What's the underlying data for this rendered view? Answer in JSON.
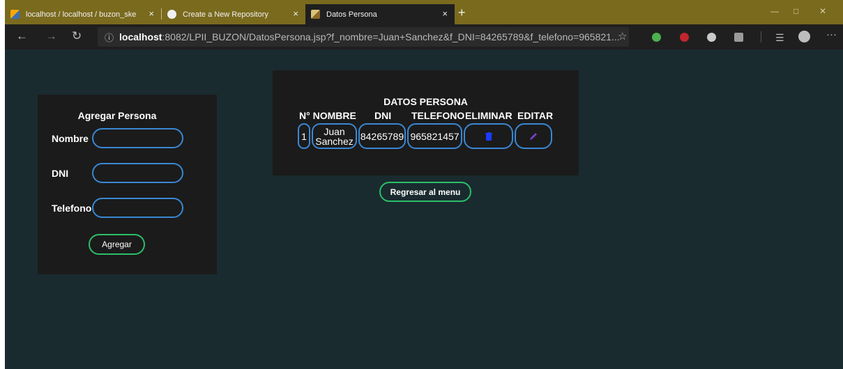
{
  "browser": {
    "tabs": [
      {
        "title": "localhost / localhost / buzon_ske"
      },
      {
        "title": "Create a New Repository"
      },
      {
        "title": "Datos Persona"
      }
    ],
    "close_glyph": "×",
    "new_tab_glyph": "+",
    "address": {
      "host": "localhost",
      "rest": ":8082/LPII_BUZON/DatosPersona.jsp?f_nombre=Juan+Sanchez&f_DNI=84265789&f_telefono=965821..."
    },
    "icons": {
      "back": "back-arrow-icon",
      "forward": "forward-arrow-icon",
      "refresh": "refresh-icon",
      "info": "info-icon",
      "star": "favorite-star-icon",
      "favorites": "favorites-list-icon",
      "profile": "profile-icon",
      "more": "more-icon"
    },
    "window": {
      "minimize": "—",
      "maximize": "□",
      "close": "✕"
    }
  },
  "form": {
    "title": "Agregar Persona",
    "fields": [
      {
        "label": "Nombre",
        "value": ""
      },
      {
        "label": "DNI",
        "value": ""
      },
      {
        "label": "Telefono",
        "value": ""
      }
    ],
    "submit_label": "Agregar"
  },
  "table": {
    "title": "DATOS PERSONA",
    "headers": [
      "N° NOMBRE",
      "DNI",
      "TELEFONO",
      "ELIMINAR",
      "EDITAR"
    ],
    "rows": [
      {
        "n": "1",
        "nombre": "Juan Sanchez",
        "dni": "84265789",
        "telefono": "965821457"
      }
    ],
    "delete_icon": "trash-icon",
    "edit_icon": "pencil-icon"
  },
  "back_label": "Regresar al menu",
  "colors": {
    "tab_bar": "#7a6a1e",
    "page_bg": "#1a2b30",
    "panel_bg": "#1b1b1b",
    "input_border": "#3a88d4",
    "button_border": "#2bbf6a",
    "delete_icon": "#1a3cff",
    "edit_icon": "#7a3fc8"
  }
}
